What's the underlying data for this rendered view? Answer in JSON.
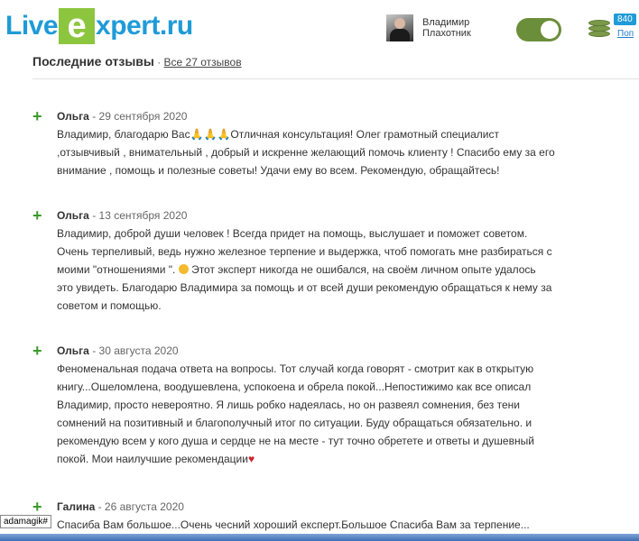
{
  "header": {
    "logo_live": "Live",
    "logo_e": "e",
    "logo_rest": "xpert.ru",
    "user_first_name": "Владимир",
    "user_last_name": "Плахотник",
    "badge_count": "840",
    "top_up_label": "Поп"
  },
  "colors": {
    "brand_blue": "#1f9bd7",
    "brand_green": "#8cc63f",
    "toggle_on": "#6b8e3a",
    "positive_plus": "#3a9a2a",
    "heart": "#d0232f"
  },
  "icons": {
    "plus": "+",
    "heart": "♥"
  },
  "section": {
    "title": "Последние отзывы",
    "separator": " · ",
    "all_reviews_link": "Все 27 отзывов"
  },
  "reviews": [
    {
      "author": "Ольга",
      "date": " - 29 сентября 2020",
      "lines": [
        "Владимир, благодарю Вас🙏🙏🙏Отличная консультация! Олег грамотный специалист",
        ",отзывчивый , внимательный , добрый и искренне желающий помочь клиенту ! Спасибо ему за его",
        "внимание , помощь и полезные советы! Удачи ему во всем. Рекомендую, обращайтесь!"
      ]
    },
    {
      "author": "Ольга",
      "date": " - 13 сентября 2020",
      "lines": [
        "Владимир, доброй души человек ! Всегда придет на помощь, выслушает и поможет советом.",
        "Очень терпеливый, ведь нужно железное терпение и выдержка, чтоб помогать мне разбираться с",
        "моими \"отношениями \".",
        "это увидеть. Благодарю Владимира за помощь и от всей души рекомендую обращаться к нему за",
        "советом и помощью."
      ],
      "line3_tail": " Этот эксперт никогда не ошибался, на своём личном опыте удалось"
    },
    {
      "author": "Ольга",
      "date": " - 30 августа 2020",
      "lines": [
        "Феноменальная подача ответа на вопросы. Тот случай когда говорят - смотрит как в открытую",
        "книгу...Ошеломлена, воодушевлена, успокоена и обрела покой...Непостижимо как все описал",
        "Владимир, просто невероятно. Я лишь робко надеялась, но он развеял сомнения, без тени",
        "сомнений на позитивный и благополучный итог по ситуации. Буду обращаться обязательно. и",
        "рекомендую всем у кого душа и сердце не на месте - тут точно обретете и ответы и душевный",
        "покой. Мои наилучшие рекомендации"
      ]
    },
    {
      "author": "Галина",
      "date": " - 26 августа 2020",
      "lines": [
        "Спасиба Вам большое...Очень чесний хороший експерт.Большое Спасиба Вам за терпение..."
      ]
    }
  ],
  "tooltip": "adamagik#"
}
